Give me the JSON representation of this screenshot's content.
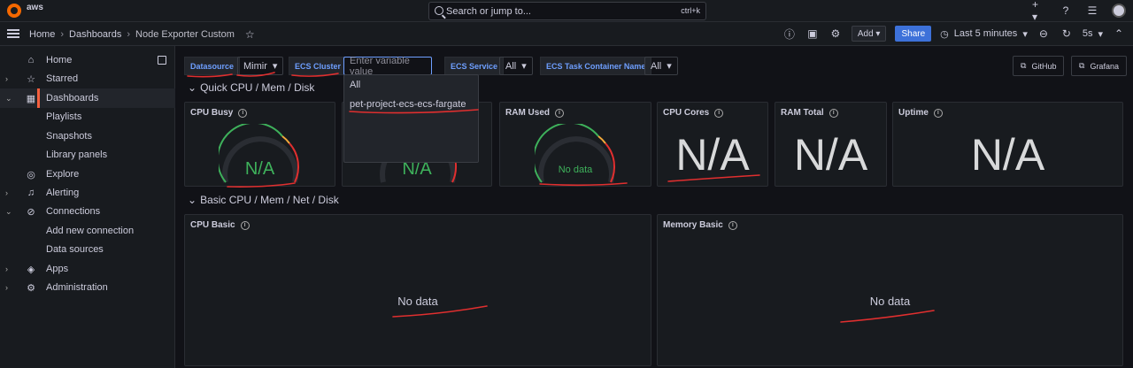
{
  "topbar": {
    "brand": "aws",
    "search_placeholder": "Search or jump to...",
    "shortcut": "ctrl+k"
  },
  "nav": {
    "crumbs": [
      "Home",
      "Dashboards",
      "Node Exporter Custom"
    ],
    "add_label": "Add",
    "share_label": "Share",
    "time_range": "Last 5 minutes",
    "refresh": "5s"
  },
  "sidebar": {
    "items": [
      {
        "label": "Home",
        "icon": "home-icon"
      },
      {
        "label": "Starred",
        "icon": "star-icon"
      },
      {
        "label": "Dashboards",
        "icon": "dashboards-icon"
      },
      {
        "label": "Playlists"
      },
      {
        "label": "Snapshots"
      },
      {
        "label": "Library panels"
      },
      {
        "label": "Explore",
        "icon": "compass-icon"
      },
      {
        "label": "Alerting",
        "icon": "bell-icon"
      },
      {
        "label": "Connections",
        "icon": "link-icon"
      },
      {
        "label": "Add new connection"
      },
      {
        "label": "Data sources"
      },
      {
        "label": "Apps",
        "icon": "apps-icon"
      },
      {
        "label": "Administration",
        "icon": "gear-icon"
      }
    ]
  },
  "variables": {
    "datasource_label": "Datasource",
    "datasource_value": "Mimir",
    "cluster_label": "ECS Cluster",
    "cluster_placeholder": "Enter variable value",
    "service_label": "ECS Service",
    "service_value": "All",
    "task_label": "ECS Task Container Name",
    "task_value": "All"
  },
  "links": {
    "github": "GitHub",
    "grafana": "Grafana"
  },
  "dropdown": {
    "options": [
      "All",
      "pet-project-ecs-ecs-fargate"
    ]
  },
  "rows": {
    "quick": "Quick CPU / Mem / Disk",
    "basic": "Basic CPU / Mem / Net / Disk"
  },
  "panels": {
    "cpu_busy": {
      "title": "CPU Busy",
      "value": "N/A"
    },
    "sys_load": {
      "value": "N/A"
    },
    "ram_used": {
      "title": "RAM Used",
      "value": "No data"
    },
    "cpu_cores": {
      "title": "CPU Cores",
      "value": "N/A"
    },
    "ram_total": {
      "title": "RAM Total",
      "value": "N/A"
    },
    "uptime": {
      "title": "Uptime",
      "value": "N/A"
    },
    "cpu_basic": {
      "title": "CPU Basic",
      "value": "No data"
    },
    "mem_basic": {
      "title": "Memory Basic",
      "value": "No data"
    }
  },
  "colors": {
    "accent": "#6e9fff",
    "primary": "#3d71d9",
    "ok": "#3eb15b",
    "annotation": "#e02f2f"
  }
}
